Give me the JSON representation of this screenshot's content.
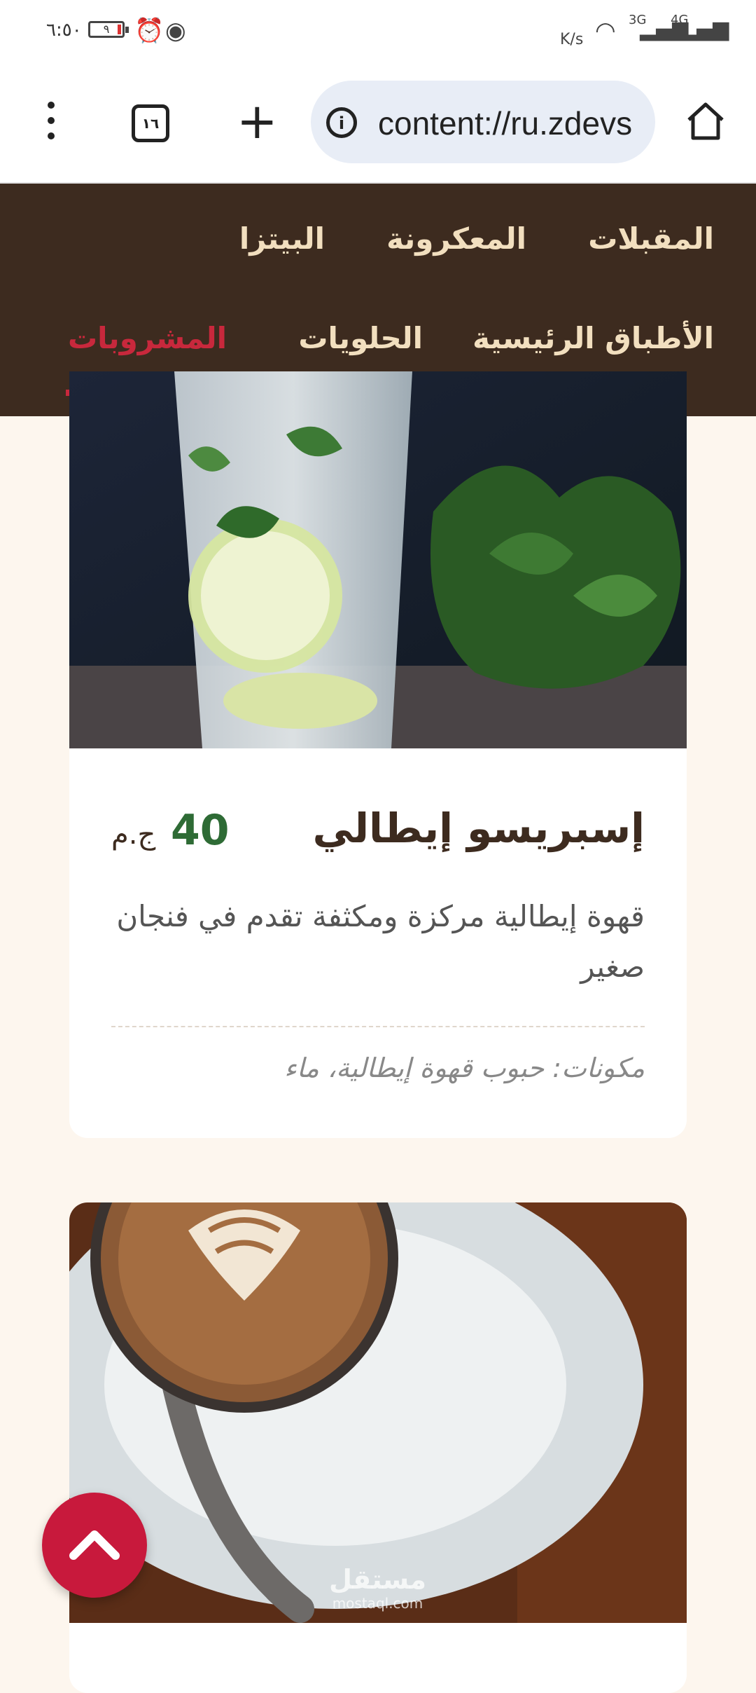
{
  "status_bar": {
    "time": "٦:٥٠",
    "battery_level": "٩",
    "network_speed_unit": "K/s",
    "signal_1": "3G",
    "signal_2": "4G"
  },
  "browser": {
    "tab_count": "١٦",
    "url": "content://ru.zdevs"
  },
  "nav": {
    "row1": [
      "المقبلات",
      "المعكرونة",
      "البيتزا"
    ],
    "row2": [
      "الأطباق الرئيسية",
      "الحلويات",
      "المشروبات"
    ],
    "active": "المشروبات",
    "active_color": "#c8283c"
  },
  "menu_item": {
    "title": "إسبريسو إيطالي",
    "price": "40",
    "currency": "ج.م",
    "description": "قهوة إيطالية مركزة ومكثفة تقدم في فنجان صغير",
    "ingredients": "مكونات: حبوب قهوة إيطالية، ماء"
  },
  "watermark": {
    "brand": "مستقل",
    "domain": "mostaql.com"
  },
  "colors": {
    "nav_bg": "#3d2b1f",
    "price": "#2e6b35",
    "accent": "#c8193c",
    "page_bg": "#fdf6ee"
  }
}
